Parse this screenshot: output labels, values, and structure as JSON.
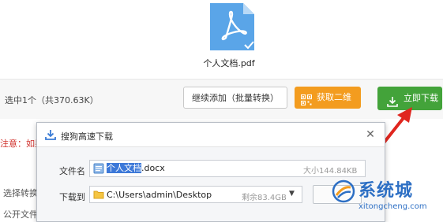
{
  "file": {
    "name": "个人文档.pdf",
    "icon": "pdf-file-icon"
  },
  "toolbar": {
    "selection_info": "选中1个（共370.63K）",
    "continue_label": "继续添加（批量转换）",
    "qr_label": "获取二维",
    "download_label": "立即下载"
  },
  "background": {
    "notice": "注意：如果",
    "select_convert": "选择转换",
    "public_file": "公开文件"
  },
  "dialog": {
    "title": "搜狗高速下载",
    "filename_label": "文件名",
    "filename_highlight": "个人文档",
    "filename_ext": ".docx",
    "file_size": "大小144.84KB",
    "saveto_label": "下载到",
    "save_path": "C:\\Users\\admin\\Desktop",
    "free_space": "剩余83.4GB"
  },
  "watermark": {
    "title": "系统城",
    "domain": "xitongcheng.com"
  },
  "colors": {
    "download_green": "#43a33a",
    "qr_orange": "#f39c1f",
    "notice_red": "#d0302b",
    "watermark_blue": "#2d6fc4",
    "pdf_blue": "#5aa5e8"
  }
}
